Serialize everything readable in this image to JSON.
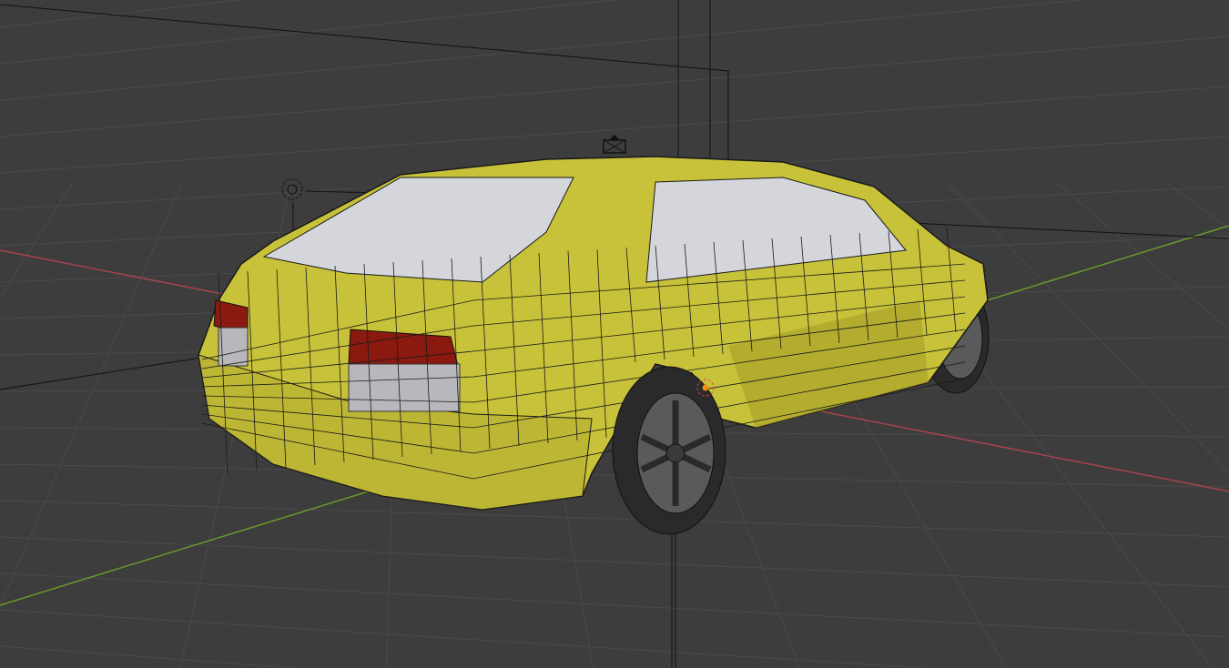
{
  "viewport": {
    "background": "#3d3d3d",
    "grid_color": "#4a4a4a",
    "x_axis_color": "#a8424f",
    "y_axis_color": "#6a9a2a"
  },
  "car": {
    "body_color": "#c8c23a",
    "body_shadow": "#8f8a1e",
    "window_color": "#d4d6dc",
    "taillight_color": "#8a1a10",
    "tire_color": "#2a2a2a",
    "rim_color": "#5a5a5a",
    "wire_color": "#1a1a1a"
  },
  "icons": [
    "camera-icon",
    "light-icon",
    "origin-point-icon"
  ]
}
